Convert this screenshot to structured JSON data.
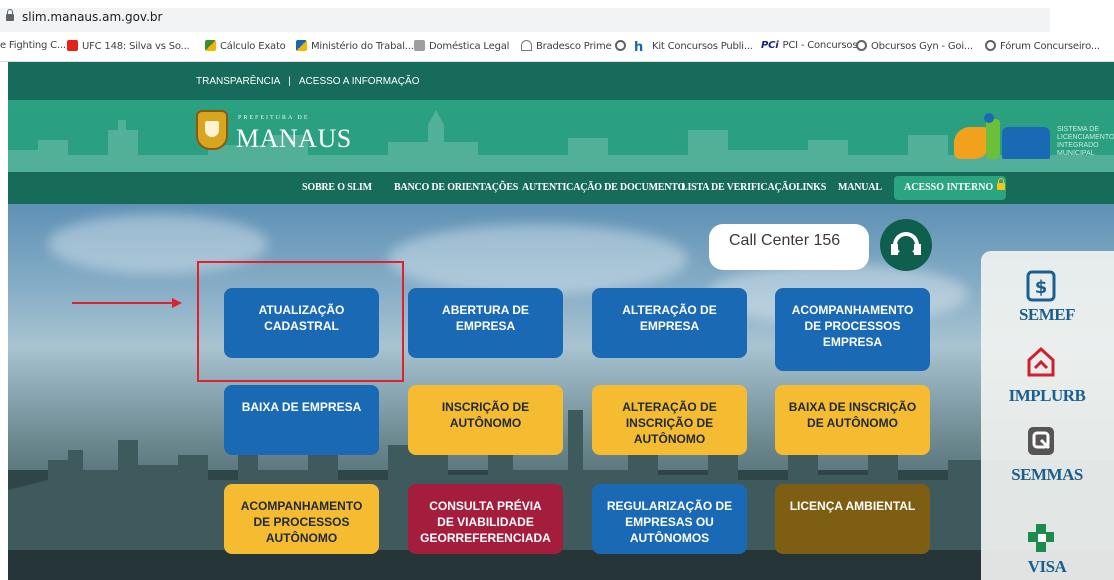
{
  "browser": {
    "url": "slim.manaus.am.gov.br",
    "bookmarks": [
      {
        "label": "e Fighting C...",
        "color": ""
      },
      {
        "label": "UFC 148: Silva vs So...",
        "color": "#e62117"
      },
      {
        "label": "Cálculo Exato",
        "color": "#3c8d2f"
      },
      {
        "label": "Ministério do Trabal...",
        "color": "#1565c0"
      },
      {
        "label": "Doméstica Legal",
        "color": "#9e9e9e"
      },
      {
        "label": "Bradesco Prime",
        "color": "#777777"
      },
      {
        "label": "",
        "color": "#5f6368"
      },
      {
        "label": "Kit Concursos Publi...",
        "color": "#1565c0"
      },
      {
        "label": "PCI - Concursos",
        "color": "#1a237e"
      },
      {
        "label": "Obcursos Gyn - Goi...",
        "color": "#5f6368"
      },
      {
        "label": "Fórum Concurseiro...",
        "color": "#5f6368"
      }
    ],
    "pci_badge": "PCi"
  },
  "site": {
    "top_links": [
      "TRANSPARÊNCIA",
      "ACESSO A INFORMAÇÃO"
    ],
    "logo_prefix": "PREFEITURA DE",
    "logo_name": "MANAUS",
    "slim_subtitle": "SISTEMA DE LICENCIAMENTO INTEGRADO MUNICIPAL",
    "nav": [
      "SOBRE O SLIM",
      "BANCO DE ORIENTAÇÕES",
      "AUTENTICAÇÃO DE DOCUMENTO",
      "LISTA DE VERIFICAÇÃO",
      "LINKS",
      "MANUAL"
    ],
    "acesso_interno": "ACESSO INTERNO",
    "call_center": "Call Center 156",
    "tiles": [
      {
        "label": "ATUALIZAÇÃO\nCADASTRAL",
        "color": "#1a69b5"
      },
      {
        "label": "ABERTURA DE\nEMPRESA",
        "color": "#1a69b5"
      },
      {
        "label": "ALTERAÇÃO DE\nEMPRESA",
        "color": "#1a69b5"
      },
      {
        "label": "ACOMPANHAMENTO\nDE PROCESSOS\nEMPRESA",
        "color": "#1a69b5"
      },
      {
        "label": "BAIXA DE EMPRESA",
        "color": "#1a69b5"
      },
      {
        "label": "INSCRIÇÃO DE\nAUTÔNOMO",
        "color": "#f5bc31"
      },
      {
        "label": "ALTERAÇÃO DE\nINSCRIÇÃO DE\nAUTÔNOMO",
        "color": "#f5bc31"
      },
      {
        "label": "BAIXA DE INSCRIÇÃO\nDE AUTÔNOMO",
        "color": "#f5bc31"
      },
      {
        "label": "ACOMPANHAMENTO\nDE PROCESSOS\nAUTÔNOMO",
        "color": "#f5bc31"
      },
      {
        "label": "CONSULTA PRÉVIA\nDE VIABILIDADE\nGEORREFERENCIADA",
        "color": "#a51d3c"
      },
      {
        "label": "REGULARIZAÇÃO DE\nEMPRESAS OU\nAUTÔNOMOS",
        "color": "#1a69b5"
      },
      {
        "label": "LICENÇA AMBIENTAL",
        "color": "#7e5e13"
      }
    ],
    "agencies": [
      {
        "name": "SEMEF",
        "icon": "dollar-icon",
        "color": "#1a5f8f"
      },
      {
        "name": "IMPLURB",
        "icon": "house-icon",
        "color": "#d0202e"
      },
      {
        "name": "SEMMAS",
        "icon": "leaf-box-icon",
        "color": "#555555"
      },
      {
        "name": "VISA",
        "icon": "cross-icon",
        "color": "#1d8a4f"
      }
    ],
    "annotation_color": "#e0202a"
  }
}
